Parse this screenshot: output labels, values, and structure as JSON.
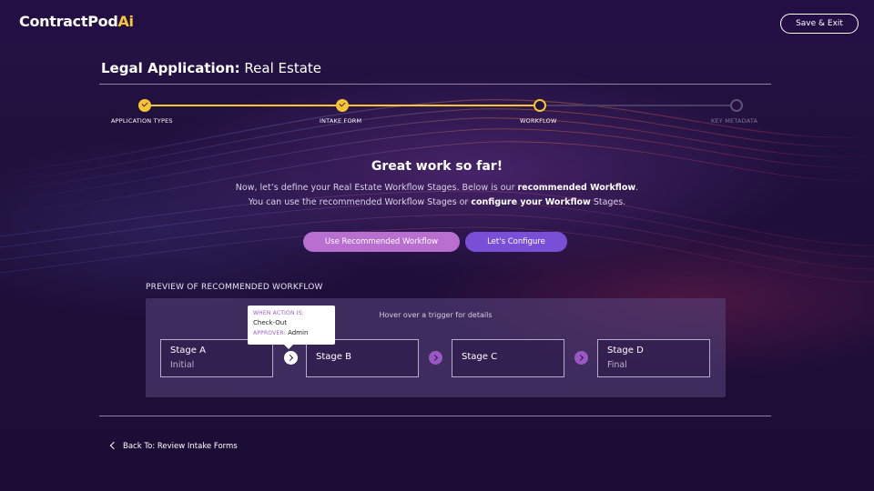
{
  "header": {
    "logo_main": "ContractPod",
    "logo_accent": "Ai",
    "save_exit_label": "Save & Exit"
  },
  "page": {
    "title_bold": "Legal Application:",
    "title_rest": "Real Estate"
  },
  "stepper": {
    "steps": [
      {
        "label": "APPLICATION TYPES",
        "state": "done"
      },
      {
        "label": "INTAKE FORM",
        "state": "done"
      },
      {
        "label": "WORKFLOW",
        "state": "current"
      },
      {
        "label": "KEY METADATA",
        "state": "todo"
      }
    ]
  },
  "intro": {
    "headline": "Great work so far!",
    "line1_a": "Now, let’s define your Real Estate Workflow Stages. Below is our",
    "line1_b": "recommended Workflow",
    "line1_c": ".",
    "line2_a": "You can use the recommended Workflow Stages or",
    "line2_b": "configure your Workflow",
    "line2_c": "Stages."
  },
  "actions": {
    "use_recommended": "Use Recommended Workflow",
    "configure": "Let's Configure"
  },
  "preview": {
    "title": "PREVIEW OF RECOMMENDED WORKFLOW",
    "hint": "Hover over a trigger for details",
    "stages": [
      {
        "name": "Stage A",
        "sub": "Initial"
      },
      {
        "name": "Stage B",
        "sub": ""
      },
      {
        "name": "Stage C",
        "sub": ""
      },
      {
        "name": "Stage D",
        "sub": "Final"
      }
    ],
    "tooltip": {
      "when_label": "WHEN ACTION IS:",
      "when_value": "Check-Out",
      "approver_label": "APPROVER:",
      "approver_value": "Admin"
    }
  },
  "footer": {
    "back_label": "Back To: Review Intake Forms"
  },
  "colors": {
    "accent_yellow": "#f7c531",
    "purple_button": "#7a4fd8",
    "pink_button": "#b86fcf",
    "background": "#1e0f38"
  }
}
